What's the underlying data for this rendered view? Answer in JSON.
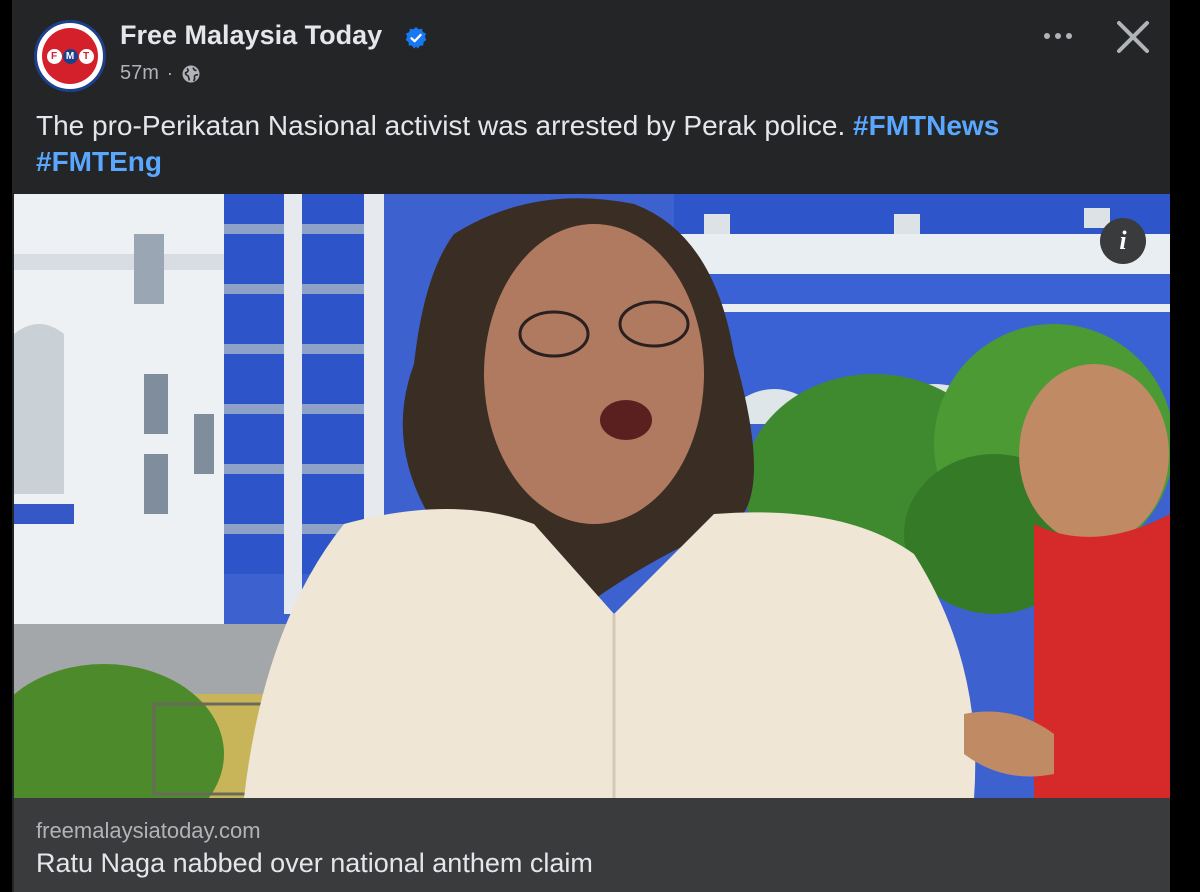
{
  "post": {
    "page_name": "Free Malaysia Today",
    "time": "57m",
    "separator": "·",
    "privacy_icon": "globe-icon",
    "verified_icon": "verified-badge-icon",
    "avatar_logo_letters": [
      "F",
      "M",
      "T"
    ],
    "caption_text": "The pro-Perikatan Nasional activist was arrested by Perak police. ",
    "hashtags": [
      "#FMTNews",
      "#FMTEng"
    ],
    "more_icon": "more-options-icon",
    "close_icon": "close-icon",
    "info_icon": "info-icon",
    "info_label": "i"
  },
  "link_preview": {
    "domain": "freemalaysiatoday.com",
    "headline": "Ratu Naga nabbed over national anthem claim"
  },
  "colors": {
    "card_background": "#242526",
    "link_box_background": "#3a3b3c",
    "hashtag": "#5aa7ff",
    "verified": "#1877f2",
    "brand_red": "#d4202a",
    "brand_blue": "#1d3f8c"
  }
}
